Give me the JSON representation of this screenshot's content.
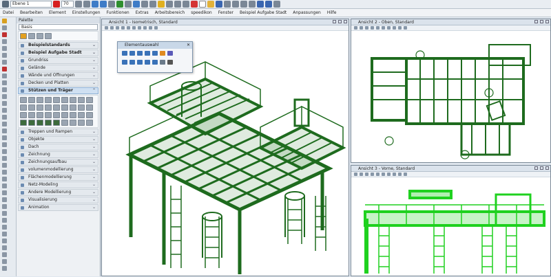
{
  "toolbar": {
    "layer": "Ebene 1",
    "line_width": "70",
    "layer_icon": "layer-icon"
  },
  "menu": [
    "Datei",
    "Bearbeiten",
    "Element",
    "Einstellungen",
    "Funktionen",
    "Extras",
    "Arbeitsbereich",
    "speedikon",
    "Fenster",
    "Beispiel Aufgabe Stadt",
    "Anpassungen",
    "Hilfe"
  ],
  "panel": {
    "title": "Palette",
    "search_value": "Basis",
    "categories_top": [
      "Beispielstandards",
      "Beispiel Aufgabe Stadt",
      "Grundriss",
      "Gelände",
      "Wände und Öffnungen",
      "Decken und Platten"
    ],
    "active_category": "Stützen und Träger",
    "categories_bottom": [
      "Treppen und Rampen",
      "Objekte",
      "Dach",
      "Zeichnung",
      "Zeichnungsaufbau",
      "volumenmodellierung",
      "Flächenmodellierung",
      "Netz-Modeling",
      "Andere Modellierung",
      "Visualisierung",
      "Animation"
    ]
  },
  "views": {
    "v1": "Ansicht 1 - Isometrisch, Standard",
    "v2": "Ansicht 2 - Oben, Standard",
    "v3": "Ansicht 3 - Vorne, Standard"
  },
  "floating_palette": {
    "title": "Elementauswahl"
  },
  "colors": {
    "structure": "#1e6b1e",
    "bright": "#1fd11f"
  }
}
